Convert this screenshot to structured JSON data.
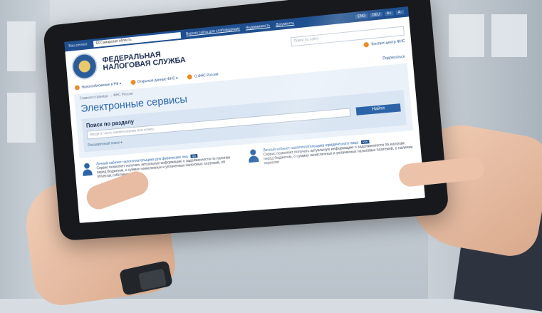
{
  "site": {
    "topbar": {
      "region_label": "Ваш регион:",
      "region_value": "63 Самарская область",
      "links": [
        "Версия сайта для слабовидящих",
        "Недвижимость",
        "Документы"
      ],
      "lang": [
        "ENG",
        "DEU",
        "А+",
        "А-"
      ]
    },
    "header": {
      "brand_line1": "ФЕДЕРАЛЬНАЯ",
      "brand_line2": "НАЛОГОВАЯ СЛУЖБА",
      "search_placeholder": "Поиск по сайту",
      "contacts": "Контакт-центр ФНС"
    },
    "subnav": {
      "items": [
        "Налогообложение в РФ",
        "Открытые данные ФНС",
        "О ФНС России"
      ],
      "report_link": "Налоговые органы",
      "feedback": "Подписаться"
    },
    "breadcrumb": "Главная страница → ФНС России",
    "page_title": "Электронные сервисы",
    "search_panel": {
      "label": "Поиск по разделу",
      "input_placeholder": "Введите часть наименования или номер",
      "button": "Найти",
      "advanced": "Расширенный поиск"
    },
    "cards": [
      {
        "title": "Личный кабинет налогоплательщика для физических лиц",
        "badge": "ФЛ",
        "text": "Сервис позволяет получать актуальную информацию о задолженности по налогам перед бюджетом, о суммах начисленных и уплаченных налоговых платежей, об объектах собственности"
      },
      {
        "title": "Личный кабинет налогоплательщика юридического лица",
        "badge": "ЮЛ",
        "text": "Сервис позволяет получать актуальную информацию о задолженности по налогам перед бюджетом, о суммах начисленных и уплаченных налоговых платежей, о наличии переплат"
      }
    ]
  }
}
